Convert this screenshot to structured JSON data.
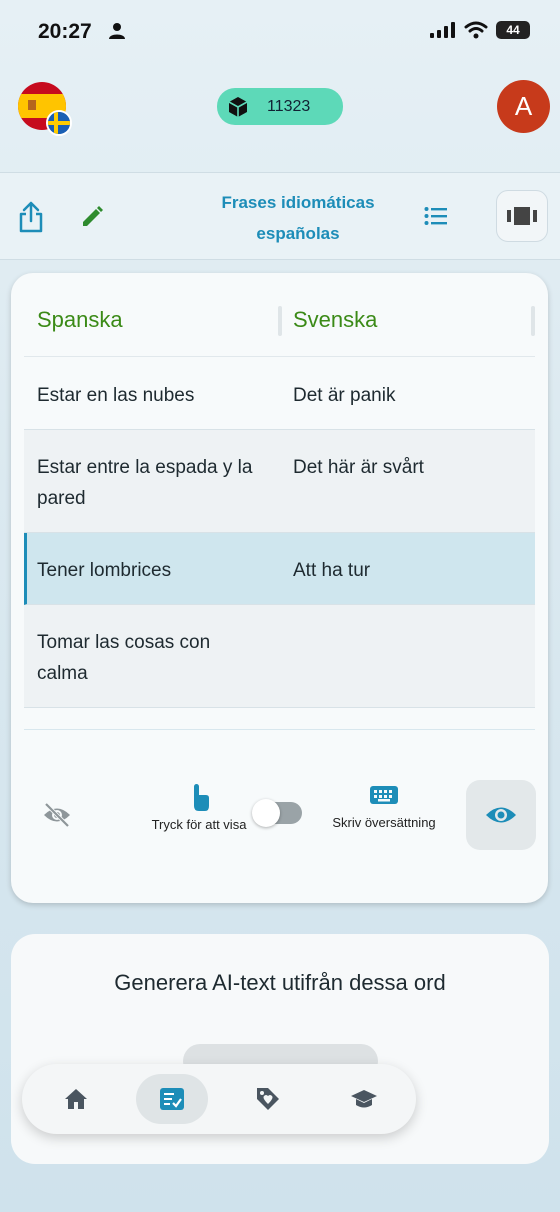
{
  "status_bar": {
    "time": "20:27",
    "battery": "44"
  },
  "header": {
    "coins": "11323",
    "avatar_letter": "A"
  },
  "toolbar": {
    "title": "Frases idiomáticas españolas"
  },
  "table": {
    "columns": [
      "Spanska",
      "Svenska"
    ],
    "rows": [
      {
        "source": "Estar en las nubes",
        "target": "Det är panik"
      },
      {
        "source": "Estar entre la espada y la pared",
        "target": "Det här är svårt"
      },
      {
        "source": "Tener lombrices",
        "target": "Att ha tur"
      },
      {
        "source": "Tomar las cosas con calma",
        "target": ""
      }
    ],
    "selected_row": 2
  },
  "controls": {
    "touch_label": "Tryck för att visa",
    "type_label": "Skriv översättning",
    "toggle_on": false
  },
  "ai_card": {
    "text": "Generera AI-text utifrån dessa ord"
  },
  "nav": {
    "items": [
      "home-icon",
      "vocabulary-list-icon",
      "tag-heart-icon",
      "graduation-cap-icon"
    ],
    "active_index": 1
  },
  "colors": {
    "accent": "#1d8db8",
    "green_heading": "#3b8a17",
    "coins_pill": "#5dd9b8",
    "avatar": "#c73a1b"
  }
}
